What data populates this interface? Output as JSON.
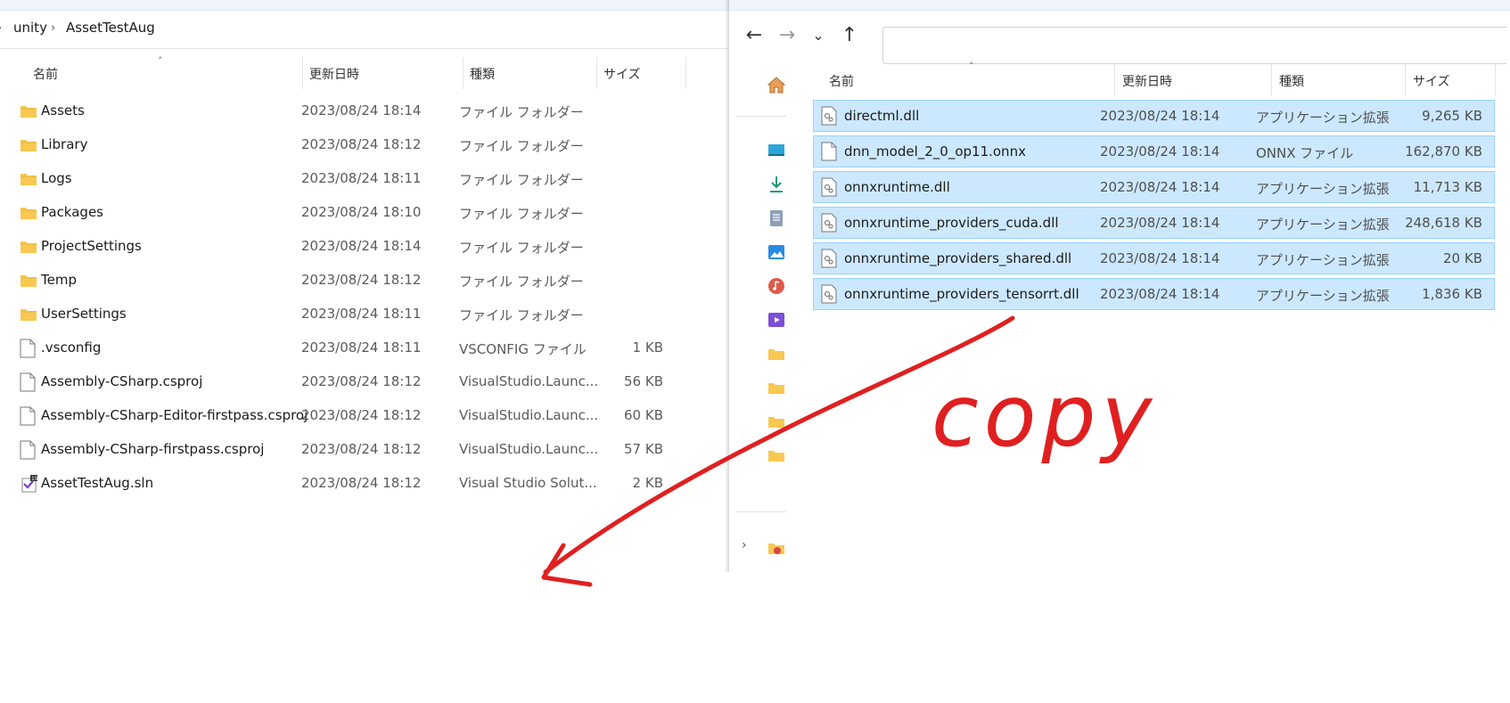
{
  "left": {
    "breadcrumb": [
      "unity",
      "AssetTestAug"
    ],
    "columns": {
      "name": "名前",
      "date": "更新日時",
      "type": "種類",
      "size": "サイズ"
    },
    "rows": [
      {
        "name": "Assets",
        "date": "2023/08/24 18:14",
        "type": "ファイル フォルダー",
        "size": "",
        "icon": "folder-icon"
      },
      {
        "name": "Library",
        "date": "2023/08/24 18:12",
        "type": "ファイル フォルダー",
        "size": "",
        "icon": "folder-icon"
      },
      {
        "name": "Logs",
        "date": "2023/08/24 18:11",
        "type": "ファイル フォルダー",
        "size": "",
        "icon": "folder-icon"
      },
      {
        "name": "Packages",
        "date": "2023/08/24 18:10",
        "type": "ファイル フォルダー",
        "size": "",
        "icon": "folder-icon"
      },
      {
        "name": "ProjectSettings",
        "date": "2023/08/24 18:14",
        "type": "ファイル フォルダー",
        "size": "",
        "icon": "folder-icon"
      },
      {
        "name": "Temp",
        "date": "2023/08/24 18:12",
        "type": "ファイル フォルダー",
        "size": "",
        "icon": "folder-icon"
      },
      {
        "name": "UserSettings",
        "date": "2023/08/24 18:11",
        "type": "ファイル フォルダー",
        "size": "",
        "icon": "folder-icon"
      },
      {
        "name": ".vsconfig",
        "date": "2023/08/24 18:11",
        "type": "VSCONFIG ファイル",
        "size": "1 KB",
        "icon": "file-icon"
      },
      {
        "name": "Assembly-CSharp.csproj",
        "date": "2023/08/24 18:12",
        "type": "VisualStudio.Launc...",
        "size": "56 KB",
        "icon": "file-icon"
      },
      {
        "name": "Assembly-CSharp-Editor-firstpass.csproj",
        "date": "2023/08/24 18:12",
        "type": "VisualStudio.Launc...",
        "size": "60 KB",
        "icon": "file-icon"
      },
      {
        "name": "Assembly-CSharp-firstpass.csproj",
        "date": "2023/08/24 18:12",
        "type": "VisualStudio.Launc...",
        "size": "57 KB",
        "icon": "file-icon"
      },
      {
        "name": "AssetTestAug.sln",
        "date": "2023/08/24 18:12",
        "type": "Visual Studio Solut...",
        "size": "2 KB",
        "icon": "visual-studio-solution-icon"
      }
    ]
  },
  "right": {
    "address": "",
    "columns": {
      "name": "名前",
      "date": "更新日時",
      "type": "種類",
      "size": "サイズ"
    },
    "rows": [
      {
        "name": "directml.dll",
        "date": "2023/08/24 18:14",
        "type": "アプリケーション拡張",
        "size": "9,265 KB",
        "icon": "dll-file-icon",
        "selected": true
      },
      {
        "name": "dnn_model_2_0_op11.onnx",
        "date": "2023/08/24 18:14",
        "type": "ONNX ファイル",
        "size": "162,870 KB",
        "icon": "file-icon",
        "selected": true
      },
      {
        "name": "onnxruntime.dll",
        "date": "2023/08/24 18:14",
        "type": "アプリケーション拡張",
        "size": "11,713 KB",
        "icon": "dll-file-icon",
        "selected": true
      },
      {
        "name": "onnxruntime_providers_cuda.dll",
        "date": "2023/08/24 18:14",
        "type": "アプリケーション拡張",
        "size": "248,618 KB",
        "icon": "dll-file-icon",
        "selected": true
      },
      {
        "name": "onnxruntime_providers_shared.dll",
        "date": "2023/08/24 18:14",
        "type": "アプリケーション拡張",
        "size": "20 KB",
        "icon": "dll-file-icon",
        "selected": true
      },
      {
        "name": "onnxruntime_providers_tensorrt.dll",
        "date": "2023/08/24 18:14",
        "type": "アプリケーション拡張",
        "size": "1,836 KB",
        "icon": "dll-file-icon",
        "selected": true
      }
    ],
    "nav_icons": [
      "home-icon",
      "desktop-icon",
      "download-icon",
      "documents-icon",
      "pictures-icon",
      "music-icon",
      "videos-icon",
      "folder-icon",
      "folder-icon",
      "folder-icon",
      "folder-icon",
      "onedrive-icon"
    ]
  },
  "annotation": {
    "text": "copy",
    "color": "#e02020"
  },
  "colors": {
    "selection_bg": "#cce8ff",
    "selection_border": "#99d1ff",
    "folder": "#f8c851"
  }
}
